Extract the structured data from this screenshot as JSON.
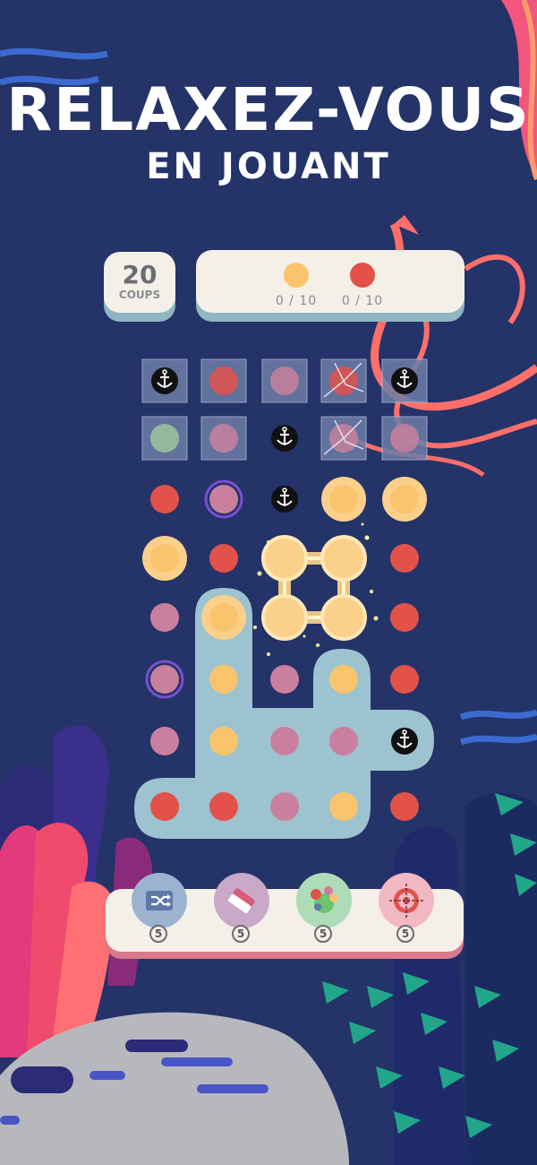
{
  "title": {
    "line1": "RELAXEZ-VOUS",
    "line2": "EN JOUANT"
  },
  "moves": {
    "count": "20",
    "label": "COUPS"
  },
  "goals": [
    {
      "color": "#f9c46b",
      "progress": "0 / 10"
    },
    {
      "color": "#e2514a",
      "progress": "0 / 10"
    }
  ],
  "tools": [
    {
      "icon": "shuffle-icon",
      "count": "5",
      "bg": "#9cb3cf"
    },
    {
      "icon": "eraser-icon",
      "count": "5",
      "bg": "#c9a8c8"
    },
    {
      "icon": "color-bomb-icon",
      "count": "5",
      "bg": "#aedcb8"
    },
    {
      "icon": "target-icon",
      "count": "5",
      "bg": "#f2b8c4"
    }
  ],
  "colors": {
    "background": "#243368",
    "dot_yellow": "#f9c46b",
    "dot_red": "#e2514a",
    "dot_pink": "#c9809e",
    "dot_green": "#9ec49e",
    "board_path": "#9cc3cf"
  },
  "board": {
    "rows": [
      [
        "anchor-ice",
        "red-ice",
        "pink-ice",
        "red-ice-cracked",
        "anchor-ice"
      ],
      [
        "green-ice",
        "pink-ice",
        "anchor",
        "pink-ice-cracked",
        "pink-ice"
      ],
      [
        "red",
        "purple-ring",
        "anchor",
        "yellow",
        "yellow"
      ],
      [
        "yellow",
        "red",
        "yellow",
        "yellow",
        "red"
      ],
      [
        "pink",
        "yellow",
        "yellow",
        "yellow",
        "red"
      ],
      [
        "purple-ring",
        "yellow",
        "pink",
        "yellow",
        "red"
      ],
      [
        "pink",
        "yellow",
        "pink",
        "pink",
        "anchor"
      ],
      [
        "red",
        "red",
        "pink",
        "yellow",
        "red"
      ]
    ]
  }
}
